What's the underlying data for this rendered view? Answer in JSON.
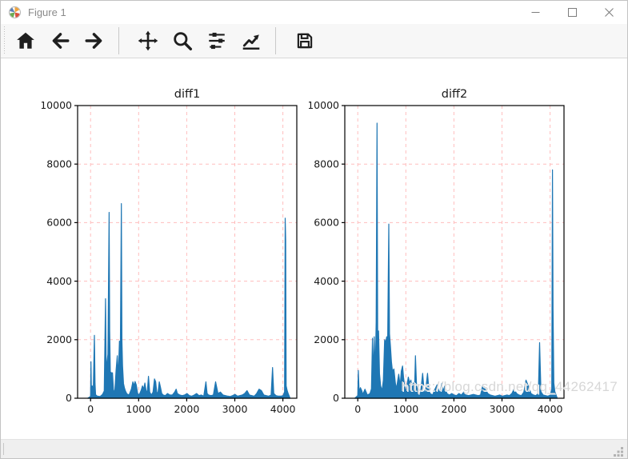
{
  "window": {
    "title": "Figure 1",
    "controls": {
      "minimize": "minimize",
      "maximize": "maximize",
      "close": "close"
    }
  },
  "toolbar": {
    "buttons": [
      "home",
      "back",
      "forward",
      "pan",
      "zoom-to-rect",
      "configure-subplots",
      "edit-axes",
      "save"
    ]
  },
  "watermark": {
    "text": "https://blog.csdn.net/qq_44262417"
  },
  "colors": {
    "series": "#1f77b4",
    "grid": "#ffbdbd",
    "axis": "#000000",
    "text": "#1a1a1a",
    "toolbar_icon": "#1f1f1f"
  },
  "chart_data": [
    {
      "type": "line",
      "title": "diff1",
      "xlabel": "",
      "ylabel": "",
      "xlim": [
        -270,
        4290
      ],
      "ylim": [
        0,
        10000
      ],
      "x_ticks": [
        0,
        1000,
        2000,
        3000,
        4000
      ],
      "y_ticks": [
        0,
        2000,
        4000,
        6000,
        8000,
        10000
      ],
      "grid": "red-dashed",
      "legend": "none",
      "points": [
        [
          -60,
          0
        ],
        [
          0,
          60
        ],
        [
          8,
          1250
        ],
        [
          18,
          150
        ],
        [
          35,
          420
        ],
        [
          55,
          150
        ],
        [
          80,
          2150
        ],
        [
          92,
          500
        ],
        [
          105,
          120
        ],
        [
          140,
          70
        ],
        [
          200,
          60
        ],
        [
          250,
          130
        ],
        [
          285,
          250
        ],
        [
          310,
          3400
        ],
        [
          325,
          900
        ],
        [
          340,
          1200
        ],
        [
          360,
          1500
        ],
        [
          385,
          6350
        ],
        [
          398,
          2300
        ],
        [
          410,
          900
        ],
        [
          430,
          870
        ],
        [
          455,
          870
        ],
        [
          475,
          300
        ],
        [
          500,
          160
        ],
        [
          530,
          950
        ],
        [
          555,
          1450
        ],
        [
          575,
          700
        ],
        [
          600,
          1950
        ],
        [
          615,
          700
        ],
        [
          640,
          6650
        ],
        [
          652,
          2000
        ],
        [
          665,
          1100
        ],
        [
          685,
          500
        ],
        [
          705,
          350
        ],
        [
          725,
          250
        ],
        [
          755,
          150
        ],
        [
          800,
          110
        ],
        [
          850,
          320
        ],
        [
          880,
          560
        ],
        [
          905,
          420
        ],
        [
          925,
          570
        ],
        [
          950,
          460
        ],
        [
          980,
          160
        ],
        [
          1010,
          110
        ],
        [
          1050,
          260
        ],
        [
          1080,
          420
        ],
        [
          1105,
          310
        ],
        [
          1130,
          520
        ],
        [
          1155,
          260
        ],
        [
          1180,
          210
        ],
        [
          1205,
          750
        ],
        [
          1230,
          210
        ],
        [
          1265,
          110
        ],
        [
          1300,
          210
        ],
        [
          1330,
          660
        ],
        [
          1355,
          560
        ],
        [
          1380,
          160
        ],
        [
          1405,
          210
        ],
        [
          1430,
          560
        ],
        [
          1455,
          360
        ],
        [
          1480,
          160
        ],
        [
          1510,
          110
        ],
        [
          1555,
          90
        ],
        [
          1600,
          160
        ],
        [
          1650,
          110
        ],
        [
          1700,
          110
        ],
        [
          1750,
          210
        ],
        [
          1780,
          310
        ],
        [
          1805,
          160
        ],
        [
          1855,
          110
        ],
        [
          1905,
          90
        ],
        [
          1955,
          110
        ],
        [
          2005,
          160
        ],
        [
          2055,
          90
        ],
        [
          2105,
          70
        ],
        [
          2155,
          110
        ],
        [
          2205,
          160
        ],
        [
          2255,
          90
        ],
        [
          2305,
          110
        ],
        [
          2355,
          70
        ],
        [
          2400,
          560
        ],
        [
          2425,
          160
        ],
        [
          2455,
          110
        ],
        [
          2505,
          90
        ],
        [
          2555,
          110
        ],
        [
          2600,
          560
        ],
        [
          2650,
          160
        ],
        [
          2700,
          210
        ],
        [
          2755,
          110
        ],
        [
          2805,
          90
        ],
        [
          2855,
          70
        ],
        [
          2905,
          60
        ],
        [
          2955,
          90
        ],
        [
          3005,
          130
        ],
        [
          3055,
          70
        ],
        [
          3105,
          90
        ],
        [
          3155,
          110
        ],
        [
          3205,
          160
        ],
        [
          3255,
          260
        ],
        [
          3305,
          110
        ],
        [
          3355,
          90
        ],
        [
          3405,
          70
        ],
        [
          3455,
          160
        ],
        [
          3505,
          310
        ],
        [
          3555,
          260
        ],
        [
          3605,
          110
        ],
        [
          3655,
          90
        ],
        [
          3705,
          70
        ],
        [
          3755,
          110
        ],
        [
          3785,
          1050
        ],
        [
          3810,
          160
        ],
        [
          3855,
          90
        ],
        [
          3905,
          70
        ],
        [
          3955,
          70
        ],
        [
          4005,
          90
        ],
        [
          4035,
          220
        ],
        [
          4048,
          6150
        ],
        [
          4058,
          5400
        ],
        [
          4068,
          420
        ],
        [
          4090,
          260
        ],
        [
          4110,
          160
        ],
        [
          4150,
          0
        ]
      ]
    },
    {
      "type": "line",
      "title": "diff2",
      "xlabel": "",
      "ylabel": "",
      "xlim": [
        -270,
        4290
      ],
      "ylim": [
        0,
        10000
      ],
      "x_ticks": [
        0,
        1000,
        2000,
        3000,
        4000
      ],
      "y_ticks": [
        0,
        2000,
        4000,
        6000,
        8000,
        10000
      ],
      "grid": "red-dashed",
      "legend": "none",
      "points": [
        [
          -60,
          0
        ],
        [
          0,
          90
        ],
        [
          12,
          950
        ],
        [
          28,
          220
        ],
        [
          55,
          360
        ],
        [
          82,
          260
        ],
        [
          105,
          130
        ],
        [
          150,
          310
        ],
        [
          200,
          110
        ],
        [
          255,
          160
        ],
        [
          285,
          320
        ],
        [
          305,
          2050
        ],
        [
          322,
          720
        ],
        [
          342,
          2100
        ],
        [
          362,
          830
        ],
        [
          382,
          2600
        ],
        [
          400,
          9400
        ],
        [
          415,
          1250
        ],
        [
          432,
          2300
        ],
        [
          452,
          830
        ],
        [
          475,
          420
        ],
        [
          505,
          260
        ],
        [
          532,
          620
        ],
        [
          558,
          2000
        ],
        [
          580,
          1900
        ],
        [
          602,
          2100
        ],
        [
          622,
          2050
        ],
        [
          645,
          5950
        ],
        [
          660,
          2200
        ],
        [
          678,
          1800
        ],
        [
          700,
          1250
        ],
        [
          722,
          920
        ],
        [
          752,
          1000
        ],
        [
          782,
          520
        ],
        [
          805,
          320
        ],
        [
          832,
          620
        ],
        [
          852,
          820
        ],
        [
          882,
          420
        ],
        [
          905,
          920
        ],
        [
          932,
          1100
        ],
        [
          952,
          720
        ],
        [
          982,
          320
        ],
        [
          1005,
          260
        ],
        [
          1052,
          720
        ],
        [
          1082,
          520
        ],
        [
          1105,
          620
        ],
        [
          1132,
          320
        ],
        [
          1155,
          520
        ],
        [
          1182,
          320
        ],
        [
          1200,
          1450
        ],
        [
          1222,
          420
        ],
        [
          1255,
          220
        ],
        [
          1305,
          160
        ],
        [
          1350,
          850
        ],
        [
          1382,
          220
        ],
        [
          1405,
          160
        ],
        [
          1450,
          850
        ],
        [
          1482,
          260
        ],
        [
          1505,
          160
        ],
        [
          1555,
          110
        ],
        [
          1605,
          310
        ],
        [
          1650,
          460
        ],
        [
          1705,
          160
        ],
        [
          1750,
          510
        ],
        [
          1782,
          220
        ],
        [
          1805,
          410
        ],
        [
          1855,
          160
        ],
        [
          1905,
          110
        ],
        [
          1955,
          160
        ],
        [
          2005,
          110
        ],
        [
          2055,
          90
        ],
        [
          2105,
          160
        ],
        [
          2155,
          110
        ],
        [
          2205,
          210
        ],
        [
          2255,
          110
        ],
        [
          2305,
          90
        ],
        [
          2355,
          110
        ],
        [
          2405,
          130
        ],
        [
          2455,
          110
        ],
        [
          2505,
          90
        ],
        [
          2555,
          110
        ],
        [
          2600,
          460
        ],
        [
          2650,
          310
        ],
        [
          2705,
          160
        ],
        [
          2755,
          110
        ],
        [
          2805,
          90
        ],
        [
          2855,
          70
        ],
        [
          2905,
          90
        ],
        [
          2955,
          110
        ],
        [
          3005,
          70
        ],
        [
          3055,
          90
        ],
        [
          3105,
          110
        ],
        [
          3155,
          90
        ],
        [
          3205,
          160
        ],
        [
          3250,
          310
        ],
        [
          3305,
          160
        ],
        [
          3355,
          110
        ],
        [
          3405,
          90
        ],
        [
          3455,
          210
        ],
        [
          3500,
          620
        ],
        [
          3550,
          410
        ],
        [
          3605,
          160
        ],
        [
          3655,
          110
        ],
        [
          3705,
          90
        ],
        [
          3755,
          160
        ],
        [
          3782,
          1900
        ],
        [
          3810,
          220
        ],
        [
          3855,
          110
        ],
        [
          3905,
          90
        ],
        [
          3955,
          70
        ],
        [
          4005,
          110
        ],
        [
          4035,
          320
        ],
        [
          4050,
          7800
        ],
        [
          4062,
          3050
        ],
        [
          4078,
          520
        ],
        [
          4100,
          220
        ],
        [
          4150,
          0
        ]
      ]
    }
  ]
}
